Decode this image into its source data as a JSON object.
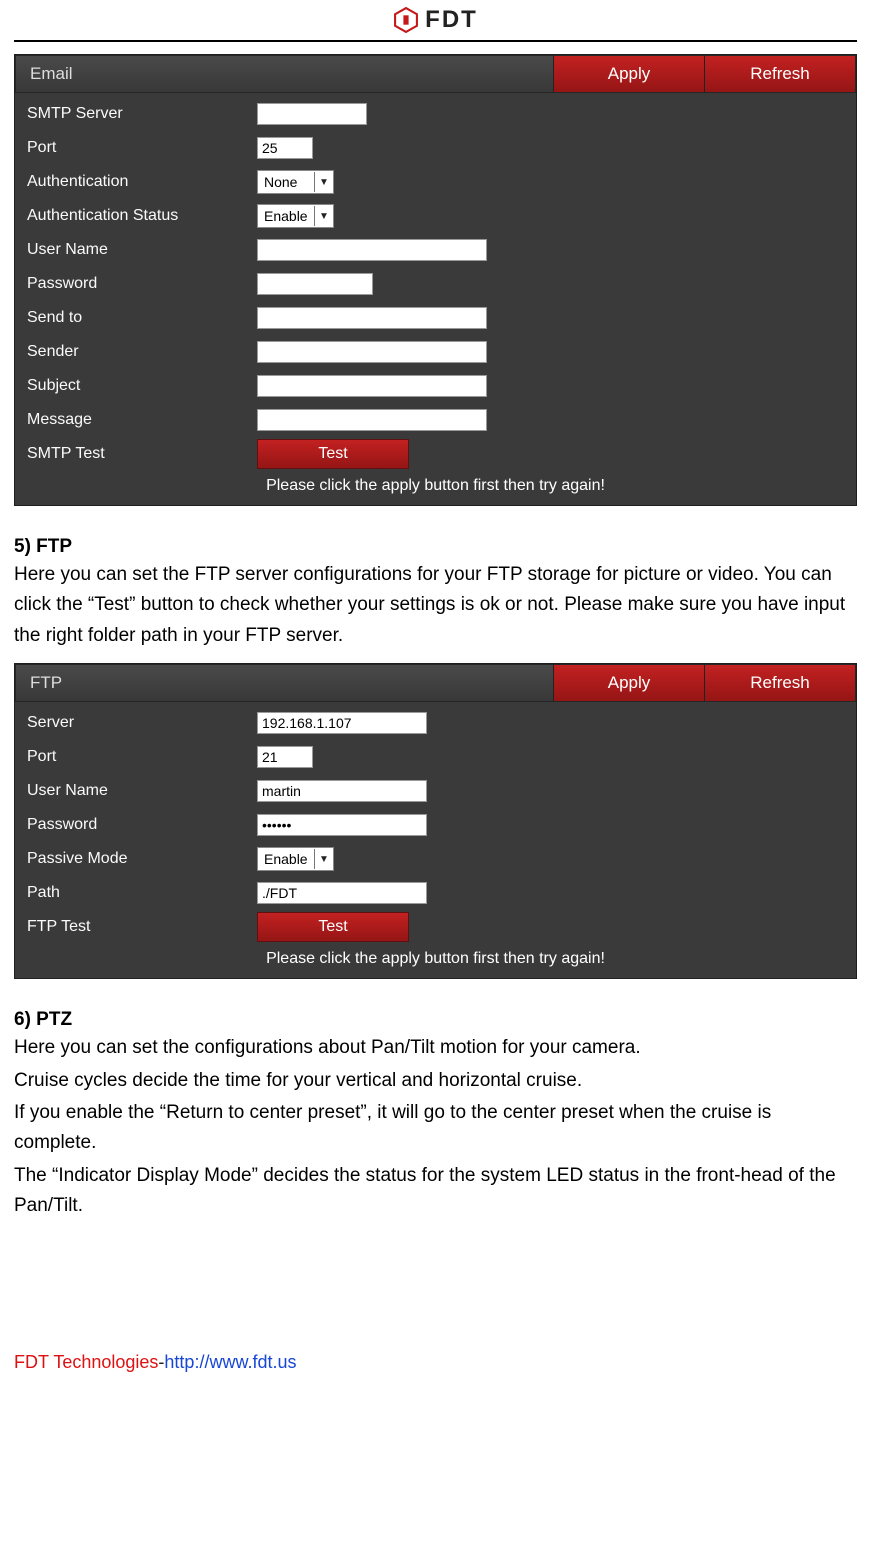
{
  "header": {
    "brand": "FDT"
  },
  "email_panel": {
    "title": "Email",
    "apply": "Apply",
    "refresh": "Refresh",
    "rows": {
      "smtp_server_label": "SMTP Server",
      "smtp_server_value": "",
      "port_label": "Port",
      "port_value": "25",
      "auth_label": "Authentication",
      "auth_value": "None",
      "auth_status_label": "Authentication Status",
      "auth_status_value": "Enable",
      "user_label": "User Name",
      "user_value": "",
      "password_label": "Password",
      "password_value": "",
      "send_to_label": "Send to",
      "send_to_value": "",
      "sender_label": "Sender",
      "sender_value": "",
      "subject_label": "Subject",
      "subject_value": "",
      "message_label": "Message",
      "message_value": "",
      "test_label": "SMTP Test",
      "test_button": "Test"
    },
    "note": "Please click the apply button first then try again!"
  },
  "doc1": {
    "title": "5) FTP",
    "p1": "Here you can set the FTP server configurations for your FTP storage for picture or video. You can click the “Test” button to check whether your settings is ok or not. Please make sure you have input the right folder path in your FTP server."
  },
  "ftp_panel": {
    "title": "FTP",
    "apply": "Apply",
    "refresh": "Refresh",
    "rows": {
      "server_label": "Server",
      "server_value": "192.168.1.107",
      "port_label": "Port",
      "port_value": "21",
      "user_label": "User Name",
      "user_value": "martin",
      "password_label": "Password",
      "password_value": "••••••",
      "passive_label": "Passive Mode",
      "passive_value": "Enable",
      "path_label": "Path",
      "path_value": "./FDT",
      "test_label": "FTP Test",
      "test_button": "Test"
    },
    "note": "Please click the apply button first then try again!"
  },
  "doc2": {
    "title": "6) PTZ",
    "p1": "Here you can set the configurations about Pan/Tilt motion for your camera.",
    "p2": "Cruise cycles decide the time for your vertical and horizontal cruise.",
    "p3": "If you enable the “Return to center preset”, it will go to the center preset when the cruise is complete.",
    "p4": "The “Indicator Display Mode” decides the status for the system LED status in the front-head of the Pan/Tilt."
  },
  "footer": {
    "company": "FDT Technologies",
    "dash": "-",
    "proto": "http://",
    "url": "www.fdt.us"
  }
}
